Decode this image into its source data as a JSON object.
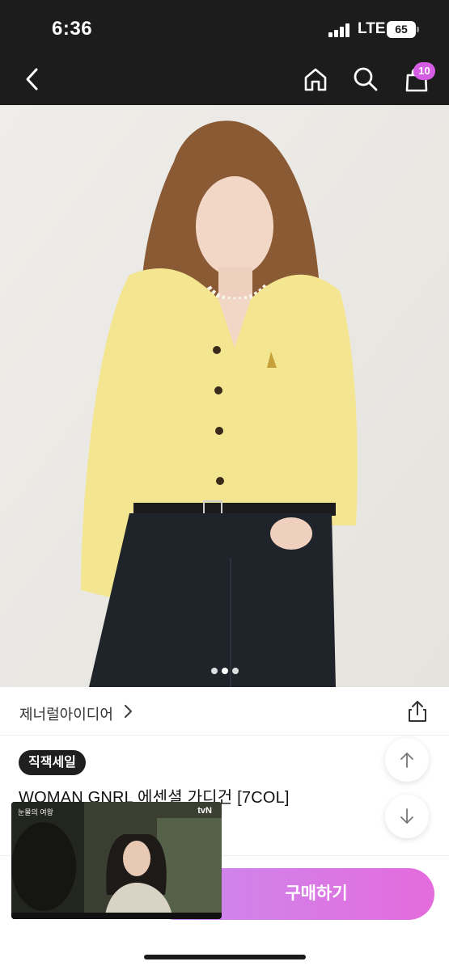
{
  "status_bar": {
    "time": "6:36",
    "network": "LTE",
    "battery": "65"
  },
  "header": {
    "cart_count": "10"
  },
  "gallery": {
    "total_images": 3,
    "current_index": 1
  },
  "product": {
    "brand": "제너럴아이디어",
    "tag": "직잭세일",
    "title": "WOMAN GNRL 에센셜 가디건 [7COL]"
  },
  "actions": {
    "buy_label": "구매하기"
  },
  "pip": {
    "caption": "눈물의 여왕",
    "channel": "tvN"
  },
  "colors": {
    "accent": "#e46bdc",
    "header_bg": "#1c1c1c",
    "badge": "#d55de4"
  }
}
